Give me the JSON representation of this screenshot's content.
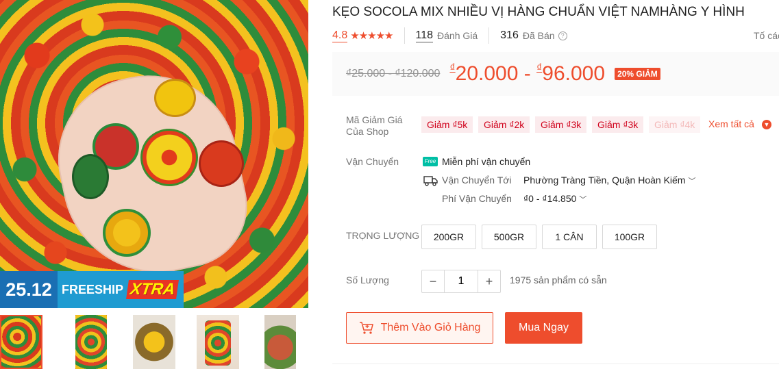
{
  "product": {
    "title": "KẸO SOCOLA MIX NHIỀU VỊ HÀNG CHUẨN VIỆT NAMHÀNG Y HÌNH",
    "rating": "4.8",
    "stars": "★★★★★",
    "reviews_count": "118",
    "reviews_label": "Đánh Giá",
    "sold_count": "316",
    "sold_label": "Đã Bán",
    "report_label": "Tố các"
  },
  "price": {
    "old": "₫25.000 - ₫120.000",
    "currency": "₫",
    "min": "20.000",
    "max": "96.000",
    "separator": " - ",
    "discount": "20% GIẢM"
  },
  "vouchers": {
    "label_line1": "Mã Giảm Giá",
    "label_line2": "Của Shop",
    "items": [
      "Giảm ₫5k",
      "Giảm ₫2k",
      "Giảm ₫3k",
      "Giảm ₫3k",
      "Giảm ₫4k"
    ],
    "see_all": "Xem tất cả"
  },
  "shipping": {
    "label": "Vận Chuyển",
    "free_badge": "Free",
    "free_text": "Miễn phí vận chuyển",
    "to_label": "Vận Chuyển Tới",
    "to_value": "Phường Tràng Tiền, Quận Hoàn Kiếm",
    "fee_label": "Phí Vận Chuyển",
    "fee_value": "₫0 - ₫14.850"
  },
  "variants": {
    "label": "TRỌNG LƯỢNG",
    "options": [
      "200GR",
      "500GR",
      "1 CÂN",
      "100GR"
    ]
  },
  "quantity": {
    "label": "Số Lượng",
    "value": "1",
    "minus": "−",
    "plus": "+",
    "stock": "1975 sản phẩm có sẵn"
  },
  "actions": {
    "add_to_cart": "Thêm Vào Giỏ Hàng",
    "buy_now": "Mua Ngay"
  },
  "banner": {
    "date": "25.12",
    "freeship": "FREESHIP",
    "xtra": "XTRA"
  },
  "colors": {
    "accent": "#ee4d2d",
    "banner_blue": "#1f9bd1",
    "free_badge": "#00bfa5"
  }
}
